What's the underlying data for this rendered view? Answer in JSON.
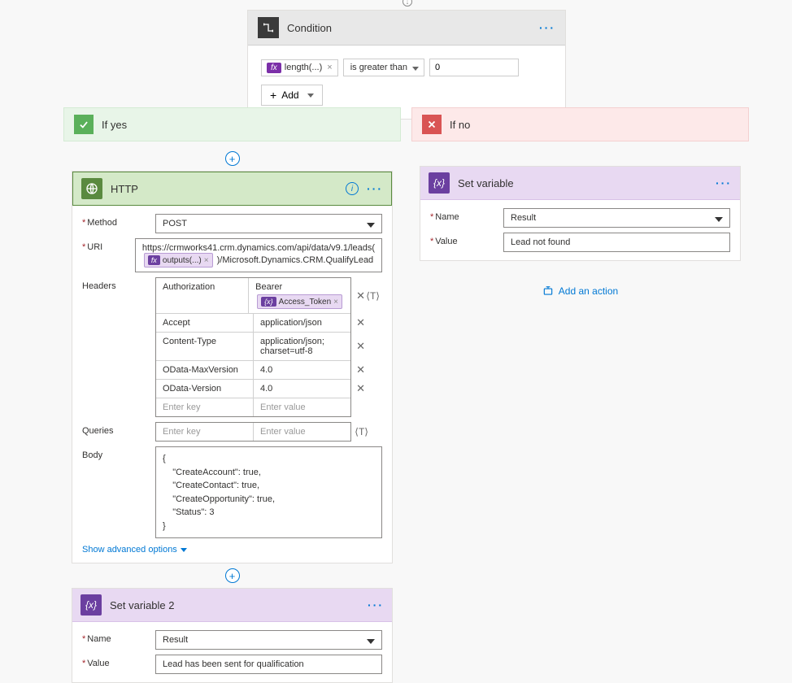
{
  "condition": {
    "title": "Condition",
    "expr_chip": "length(...)",
    "operator": "is greater than",
    "value": "0",
    "add_label": "Add"
  },
  "branches": {
    "yes": {
      "label": "If yes"
    },
    "no": {
      "label": "If no"
    }
  },
  "http": {
    "title": "HTTP",
    "labels": {
      "method": "Method",
      "uri": "URI",
      "headers": "Headers",
      "queries": "Queries",
      "body": "Body"
    },
    "method": "POST",
    "uri_prefix": "https://crmworks41.crm.dynamics.com/api/data/v9.1/leads(",
    "uri_token": "outputs(...)",
    "uri_suffix": ")/Microsoft.Dynamics.CRM.QualifyLead",
    "headers": [
      {
        "key": "Authorization",
        "value_prefix": "Bearer",
        "token": "Access_Token"
      },
      {
        "key": "Accept",
        "value": "application/json"
      },
      {
        "key": "Content-Type",
        "value": "application/json; charset=utf-8"
      },
      {
        "key": "OData-MaxVersion",
        "value": "4.0"
      },
      {
        "key": "OData-Version",
        "value": "4.0"
      }
    ],
    "placeholders": {
      "key": "Enter key",
      "value": "Enter value"
    },
    "body": "{\n    \"CreateAccount\": true,\n    \"CreateContact\": true,\n    \"CreateOpportunity\": true,\n    \"Status\": 3\n}",
    "advanced_link": "Show advanced options"
  },
  "set_variable_yes": {
    "title": "Set variable 2",
    "labels": {
      "name": "Name",
      "value": "Value"
    },
    "name": "Result",
    "value": "Lead has been sent for qualification"
  },
  "set_variable_no": {
    "title": "Set variable",
    "labels": {
      "name": "Name",
      "value": "Value"
    },
    "name": "Result",
    "value": "Lead not found"
  },
  "add_action": "Add an action"
}
